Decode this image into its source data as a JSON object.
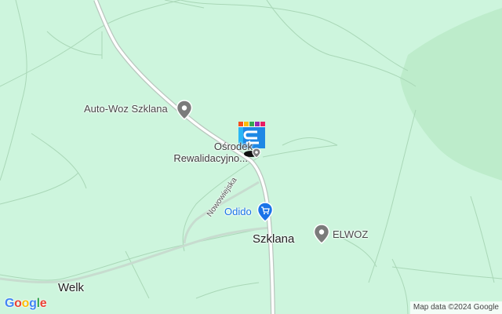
{
  "labels": {
    "autowoz": "Auto-Woz Szklana",
    "osrodek_line1": "Ośrodek",
    "osrodek_line2": "Rewalidacyjno...",
    "road": "Nowowiejska",
    "odido": "Odido",
    "szklana": "Szklana",
    "elwoz": "ELWOZ",
    "welk": "Welk"
  },
  "logo": {
    "text": [
      "G",
      "o",
      "o",
      "g",
      "l",
      "e"
    ],
    "colors": [
      "#4285F4",
      "#EA4335",
      "#FBBC05",
      "#4285F4",
      "#34A853",
      "#EA4335"
    ]
  },
  "attribution": "Map data ©2024 Google",
  "colors": {
    "land": "#cdf5dd",
    "forest": "#b9ecc9",
    "road": "#ffffff",
    "track": "#a7cdb4",
    "poi_gray": "#7b7b7b",
    "poi_shopping": "#1a73e8"
  },
  "icons": [
    "place-pin-icon",
    "shopping-cart-pin-icon",
    "transit-logo-icon"
  ]
}
